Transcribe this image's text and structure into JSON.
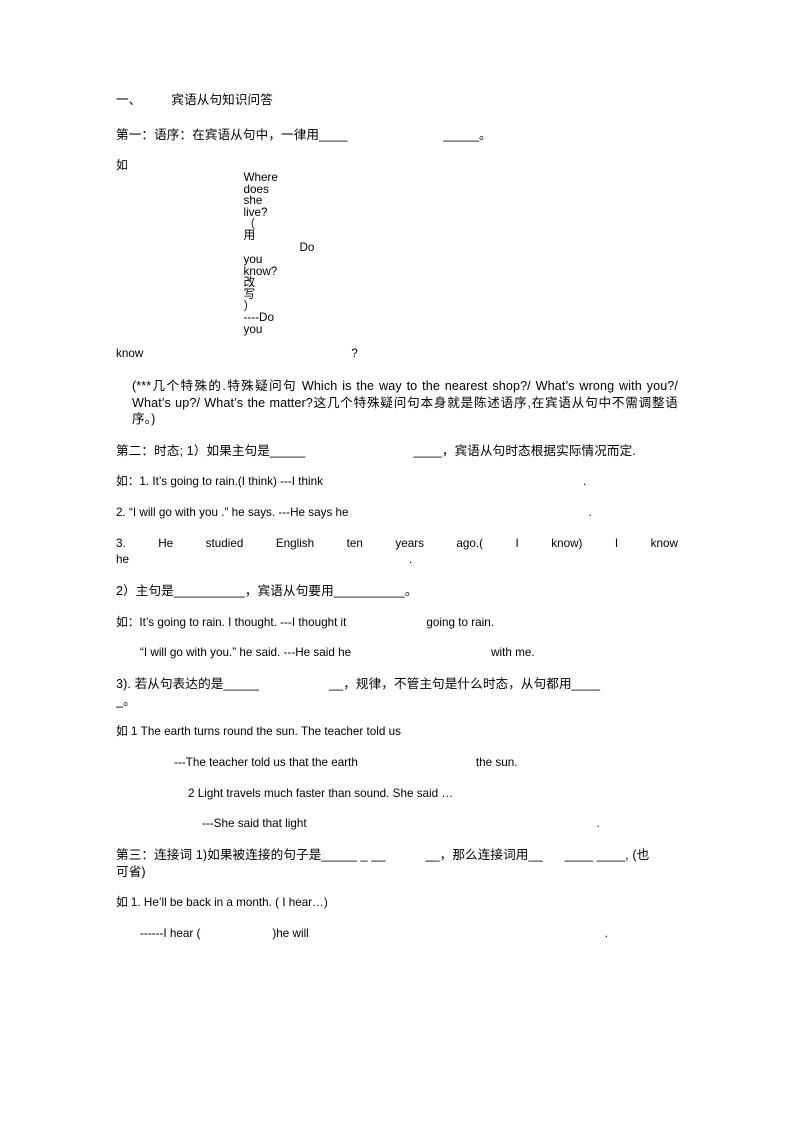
{
  "document": {
    "heading": {
      "number": "一、",
      "title": "宾语从句知识问答"
    },
    "sections": [
      {
        "id": "section-1-word-order",
        "lead": "第一：语序：在宾语从句中，一律用____",
        "blank_tail": "_____。",
        "example_line1_a": "如",
        "example_line1_b": "Where",
        "example_line1_c": "does",
        "example_line1_d": "she",
        "example_line1_e": "live?",
        "example_line1_f": "（",
        "example_line1_g": "用",
        "example_line1_h": "Do",
        "example_line1_i": "you",
        "example_line1_j": "know?",
        "example_line1_k": "改",
        "example_line1_l": "写",
        "example_line1_m": "）",
        "example_line1_n": "----Do",
        "example_line1_o": "you",
        "example_line2_a": "know",
        "example_line2_b": "?",
        "note": "(***几个特殊的.特殊疑问句 Which is the way to the nearest shop?/ What’s wrong with you?/ What’s up?/ What’s the matter?这几个特殊疑问句本身就是陈述语序,在宾语从句中不需调整语序。)"
      },
      {
        "id": "section-2-tense",
        "rule1_a": "第二：时态; 1）如果主句是_____",
        "rule1_b": "____，宾语从句时态根据实际情况而定.",
        "ex1_a": "如：1. It’s going to rain.(I think) ---I think",
        "ex1_b": ".",
        "ex2_a": "2. “I will go with you .” he says. ---He says he",
        "ex2_b": ".",
        "ex3_line1": [
          "3.",
          "He",
          "studied",
          "English",
          "ten",
          "years",
          "ago.(",
          "I",
          "know)",
          "I",
          "know"
        ],
        "ex3_line2_a": "he",
        "ex3_line2_b": ".",
        "rule2": "2）主句是__________，宾语从句要用__________。",
        "ex4_a": "如：It’s going to rain. I thought. ---I thought it",
        "ex4_b": "going to rain.",
        "ex5_a": "“I will go with you.” he said. ---He said he",
        "ex5_b": "with me.",
        "rule3_a": "3). 若从句表达的是_____",
        "rule3_b": "__，规律，不管主句是什么时态，从句都用____",
        "rule3_c": "_。",
        "ex6": "如 1 The earth turns round the sun. The teacher told us",
        "ex7_a": "---The teacher told us that the earth",
        "ex7_b": "the sun.",
        "ex8": "2 Light travels much faster than sound. She said …",
        "ex9_a": "---She said that light",
        "ex9_b": "."
      },
      {
        "id": "section-3-connectives",
        "rule1_a": "第三：连接词 1)如果被连接的句子是_____ _ __",
        "rule1_b": "__，那么连接词用__",
        "rule1_c": "____ ____, (也",
        "rule1_d": "可省)",
        "ex1": "如 1. He’ll be back in a month. ( I hear…)",
        "ex2_a": "------I hear (",
        "ex2_b": ")he will",
        "ex2_c": "."
      }
    ]
  }
}
